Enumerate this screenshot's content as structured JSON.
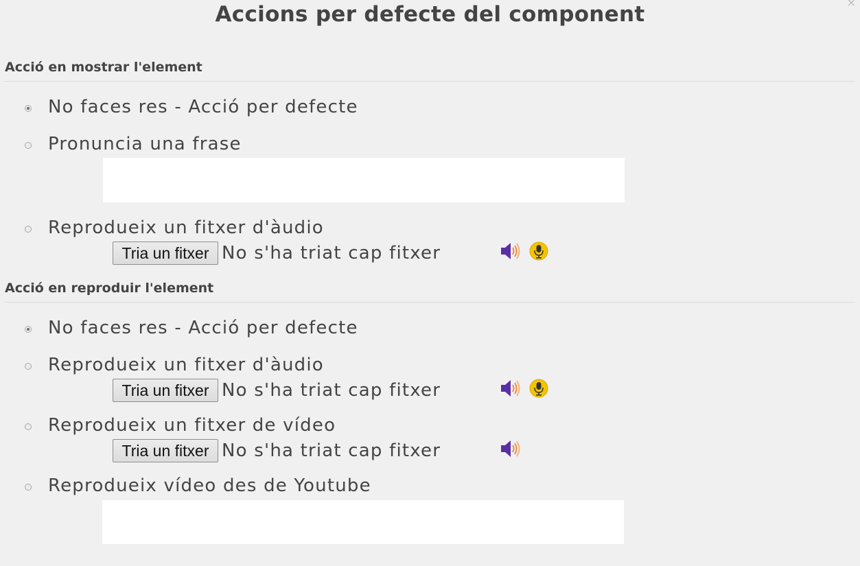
{
  "dialog": {
    "title": "Accions per defecte del component",
    "close_glyph": "×"
  },
  "on_show": {
    "heading": "Acció en mostrar l'element",
    "options": [
      {
        "label": "No faces res - Acció per defecte",
        "checked": true
      },
      {
        "label": "Pronuncia una frase",
        "checked": false,
        "text_value": ""
      },
      {
        "label": "Reprodueix un fitxer d'àudio",
        "checked": false,
        "file_button": "Tria un fitxer",
        "file_status": "No s'ha triat cap fitxer"
      }
    ]
  },
  "on_play": {
    "heading": "Acció en reproduir l'element",
    "options": [
      {
        "label": "No faces res - Acció per defecte",
        "checked": true
      },
      {
        "label": "Reprodueix un fitxer d'àudio",
        "checked": false,
        "file_button": "Tria un fitxer",
        "file_status": "No s'ha triat cap fitxer"
      },
      {
        "label": "Reprodueix un fitxer de vídeo",
        "checked": false,
        "file_button": "Tria un fitxer",
        "file_status": "No s'ha triat cap fitxer"
      },
      {
        "label": "Reprodueix vídeo des de Youtube",
        "checked": false,
        "text_value": ""
      }
    ]
  },
  "icons": {
    "speaker": "speaker-icon",
    "microphone": "microphone-icon"
  },
  "colors": {
    "background": "#f0f0f0",
    "speaker_body": "#5a2ea6",
    "speaker_waves": "#f08a3c",
    "mic_badge": "#f5c400"
  }
}
